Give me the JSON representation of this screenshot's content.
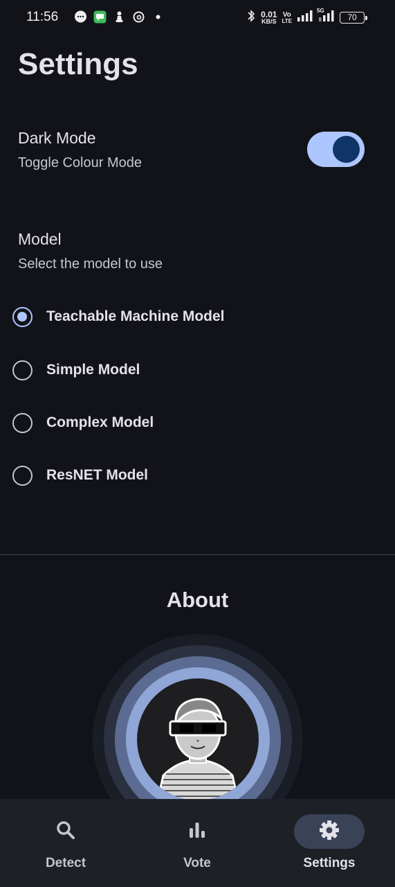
{
  "status_bar": {
    "time": "11:56",
    "net_speed_value": "0.01",
    "net_speed_unit": "KB/S",
    "volte_top": "Vo",
    "volte_bottom": "LTE",
    "network_label": "5G",
    "battery": "70"
  },
  "page_title": "Settings",
  "dark_mode": {
    "title": "Dark Mode",
    "subtitle": "Toggle Colour Mode",
    "enabled": true
  },
  "model": {
    "title": "Model",
    "subtitle": "Select the model to use",
    "options": [
      {
        "label": "Teachable Machine Model",
        "selected": true
      },
      {
        "label": "Simple Model",
        "selected": false
      },
      {
        "label": "Complex Model",
        "selected": false
      },
      {
        "label": "ResNET Model",
        "selected": false
      }
    ]
  },
  "about": {
    "title": "About"
  },
  "bottom_nav": {
    "items": [
      {
        "label": "Detect",
        "icon": "search-icon",
        "active": false
      },
      {
        "label": "Vote",
        "icon": "bar-chart-icon",
        "active": false
      },
      {
        "label": "Settings",
        "icon": "gear-icon",
        "active": true
      }
    ]
  },
  "colors": {
    "background": "#121318",
    "accent": "#aec6ff",
    "toggle_knob": "#0f3567",
    "nav_background": "#1d2025",
    "nav_active_pill": "#3a4258"
  }
}
